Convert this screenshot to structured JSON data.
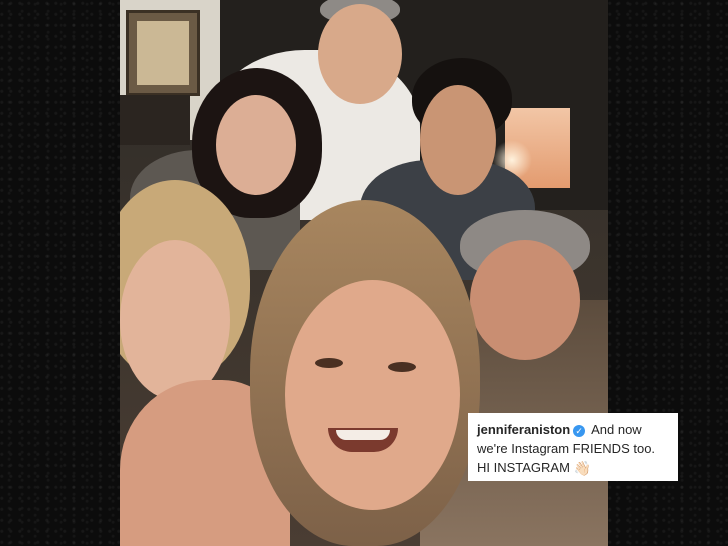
{
  "caption": {
    "username": "jenniferaniston",
    "verified_icon": "verified-check-icon",
    "text": "And now we're Instagram FRIENDS too. HI INSTAGRAM",
    "emoji_icon": "waving-hand-icon",
    "emoji": "👋🏻"
  }
}
